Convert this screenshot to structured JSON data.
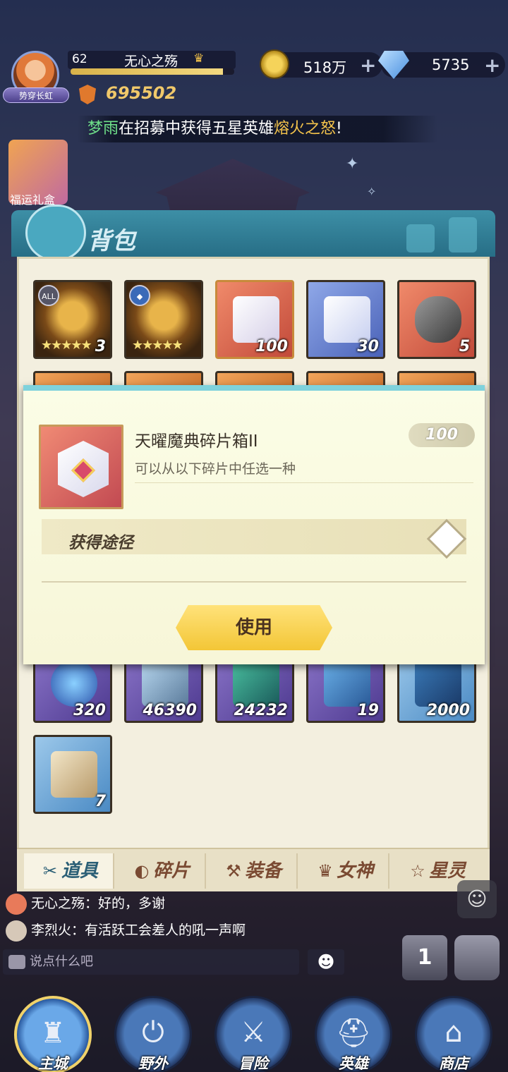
{
  "player": {
    "level": "62",
    "name": "无心之殇",
    "title_tag": "势穿长虹",
    "power": "695502",
    "xp_progress": 0.93
  },
  "resources": {
    "gold": "518万",
    "diamonds": "5735",
    "add_symbol": "+"
  },
  "announcement": {
    "player": "梦雨",
    "middle": "在招募中获得五星英雄",
    "hero": "熔火之怒",
    "end": "!"
  },
  "event": {
    "label": "福运礼盒"
  },
  "bag": {
    "title": "背包",
    "items_row1": [
      {
        "badge": "ALL",
        "count": "3",
        "stars": "★★★★★"
      },
      {
        "badge": "◆",
        "count": "",
        "stars": "★★★★★"
      },
      {
        "count": "100"
      },
      {
        "count": "30"
      },
      {
        "count": "5"
      }
    ],
    "items_row_bottom": [
      {
        "count": "320"
      },
      {
        "count": "46390"
      },
      {
        "count": "24232"
      },
      {
        "count": "19"
      },
      {
        "count": "2000"
      }
    ],
    "items_last": [
      {
        "count": "7"
      }
    ],
    "tabs": [
      {
        "label": "道具",
        "icon": "✂"
      },
      {
        "label": "碎片",
        "icon": "◐"
      },
      {
        "label": "装备",
        "icon": "⚒"
      },
      {
        "label": "女神",
        "icon": "♛"
      },
      {
        "label": "星灵",
        "icon": "☆"
      }
    ]
  },
  "popup": {
    "item_name": "天曜魔典碎片箱II",
    "description": "可以从以下碎片中任选一种",
    "count": "100",
    "source_label": "获得途径",
    "use_button": "使用"
  },
  "chat": {
    "messages": [
      {
        "user": "无心之殇",
        "text": "好的，多谢"
      },
      {
        "user": "李烈火",
        "text": "有活跃工会差人的吼一声啊"
      }
    ],
    "separator": "：",
    "input_placeholder": "说点什么吧",
    "rank_label": "1"
  },
  "nav": {
    "items": [
      {
        "label": "主城",
        "glyph": "♜"
      },
      {
        "label": "野外",
        "glyph": "⏻"
      },
      {
        "label": "冒险",
        "glyph": "⚔"
      },
      {
        "label": "英雄",
        "glyph": "⛑"
      },
      {
        "label": "商店",
        "glyph": "⌂"
      }
    ]
  }
}
